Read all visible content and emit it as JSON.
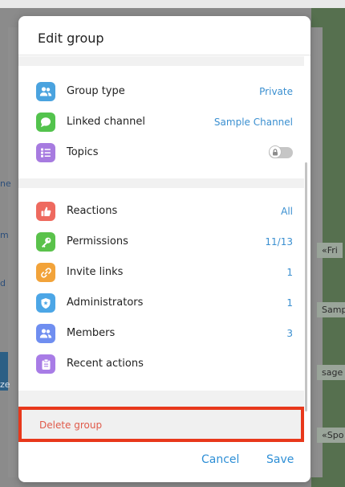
{
  "background": {
    "edge_fragments": [
      "ne",
      "m",
      "d",
      "ze"
    ],
    "right_bubbles": [
      "«Fri",
      "Samp",
      "sage",
      "«Spo"
    ]
  },
  "dialog": {
    "title": "Edit group",
    "rows_top": [
      {
        "label": "Group type",
        "value": "Private",
        "icon": "group-icon",
        "color": "#4aa3df"
      },
      {
        "label": "Linked channel",
        "value": "Sample Channel",
        "icon": "chat-bubble-icon",
        "color": "#53c34d"
      },
      {
        "label": "Topics",
        "value": "",
        "icon": "topics-list-icon",
        "color": "#a77be0",
        "toggle": false
      }
    ],
    "rows_admin": [
      {
        "label": "Reactions",
        "value": "All",
        "icon": "thumbs-up-icon",
        "color": "#ee6a5f"
      },
      {
        "label": "Permissions",
        "value": "11/13",
        "icon": "key-icon",
        "color": "#5ac24b"
      },
      {
        "label": "Invite links",
        "value": "1",
        "icon": "link-icon",
        "color": "#f2a33a"
      },
      {
        "label": "Administrators",
        "value": "1",
        "icon": "shield-icon",
        "color": "#4ca6e6"
      },
      {
        "label": "Members",
        "value": "3",
        "icon": "members-icon",
        "color": "#6f8ef0"
      },
      {
        "label": "Recent actions",
        "value": "",
        "icon": "clipboard-icon",
        "color": "#a87ce6"
      }
    ],
    "delete_label": "Delete group",
    "cancel_label": "Cancel",
    "save_label": "Save",
    "highlight_color": "#e8381b",
    "accent_color": "#3a8fd0"
  }
}
